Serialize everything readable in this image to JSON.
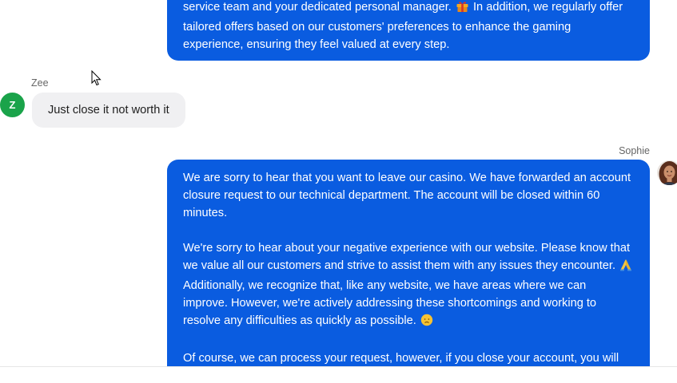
{
  "messages": [
    {
      "sender": "Sophie",
      "role": "agent",
      "text_before_gift": "service team and your dedicated personal manager.",
      "text_after_gift": "In addition, we regularly offer tailored offers based on our customers' preferences to enhance the gaming experience, ensuring they feel valued at every step.",
      "icons": [
        "gift-icon"
      ]
    },
    {
      "sender": "Zee",
      "role": "user",
      "avatar_letter": "Z",
      "text": "Just close it not worth it"
    },
    {
      "sender": "Sophie",
      "role": "agent",
      "paragraph_1": "We are sorry to hear that you want to leave our casino. We have forwarded an account closure request to our technical department. The account will be closed within 60 minutes.",
      "paragraph_2_before_pray": "We're sorry to hear about your negative experience with our website. Please know that we value all our customers and strive to assist them with any issues they encounter.",
      "paragraph_2_after_pray": "Additionally, we recognize that, like any website, we have areas where we can improve. However, we're actively addressing these shortcomings and working to resolve any difficulties as quickly as possible.",
      "paragraph_3": "Of course, we can process your request, however, if you close your account, you will",
      "icons": [
        "praying-hands-icon",
        "sad-face-icon"
      ]
    }
  ],
  "colors": {
    "agent_bubble": "#0a5ce0",
    "user_bubble": "#f0f0f2",
    "user_avatar": "#1aa34a"
  }
}
